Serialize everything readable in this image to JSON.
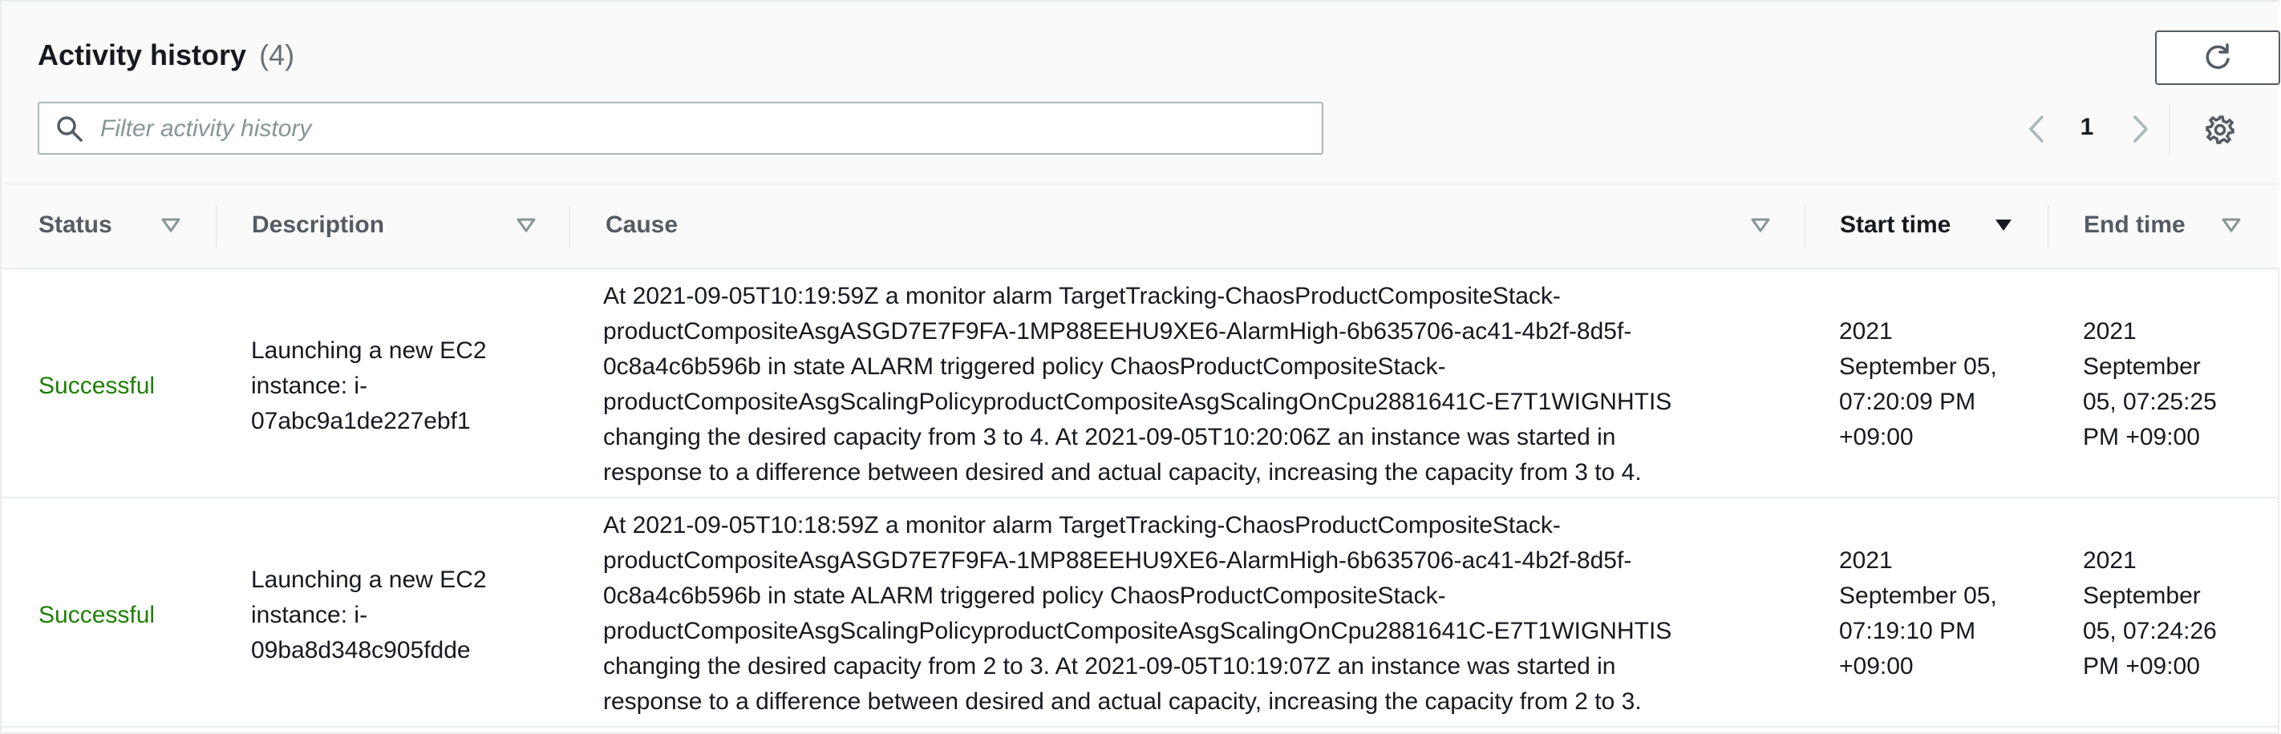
{
  "header": {
    "title": "Activity history",
    "count": "(4)",
    "refresh_icon": "refresh-icon"
  },
  "search": {
    "placeholder": "Filter activity history",
    "value": "",
    "icon": "search-icon"
  },
  "pagination": {
    "current_page": "1",
    "prev_icon": "chevron-left-icon",
    "next_icon": "chevron-right-icon",
    "settings_icon": "gear-icon"
  },
  "columns": {
    "status": "Status",
    "description": "Description",
    "cause": "Cause",
    "start_time": "Start time",
    "end_time": "End time"
  },
  "rows": [
    {
      "status": "Successful",
      "description": [
        "Launching a new EC2",
        "instance: i-",
        "07abc9a1de227ebf1"
      ],
      "cause": [
        "At 2021-09-05T10:19:59Z a monitor alarm TargetTracking-ChaosProductCompositeStack-",
        "productCompositeAsgASGD7E7F9FA-1MP88EEHU9XE6-AlarmHigh-6b635706-ac41-4b2f-8d5f-",
        "0c8a4c6b596b in state ALARM triggered policy ChaosProductCompositeStack-",
        "productCompositeAsgScalingPolicyproductCompositeAsgScalingOnCpu2881641C-E7T1WIGNHTIS",
        "changing the desired capacity from 3 to 4. At 2021-09-05T10:20:06Z an instance was started in",
        "response to a difference between desired and actual capacity, increasing the capacity from 3 to 4."
      ],
      "start_time": [
        "2021",
        "September 05,",
        "07:20:09 PM",
        "+09:00"
      ],
      "end_time": [
        "2021",
        "September",
        "05, 07:25:25",
        "PM +09:00"
      ]
    },
    {
      "status": "Successful",
      "description": [
        "Launching a new EC2",
        "instance: i-",
        "09ba8d348c905fdde"
      ],
      "cause": [
        "At 2021-09-05T10:18:59Z a monitor alarm TargetTracking-ChaosProductCompositeStack-",
        "productCompositeAsgASGD7E7F9FA-1MP88EEHU9XE6-AlarmHigh-6b635706-ac41-4b2f-8d5f-",
        "0c8a4c6b596b in state ALARM triggered policy ChaosProductCompositeStack-",
        "productCompositeAsgScalingPolicyproductCompositeAsgScalingOnCpu2881641C-E7T1WIGNHTIS",
        "changing the desired capacity from 2 to 3. At 2021-09-05T10:19:07Z an instance was started in",
        "response to a difference between desired and actual capacity, increasing the capacity from 2 to 3."
      ],
      "start_time": [
        "2021",
        "September 05,",
        "07:19:10 PM",
        "+09:00"
      ],
      "end_time": [
        "2021",
        "September",
        "05, 07:24:26",
        "PM +09:00"
      ]
    }
  ]
}
